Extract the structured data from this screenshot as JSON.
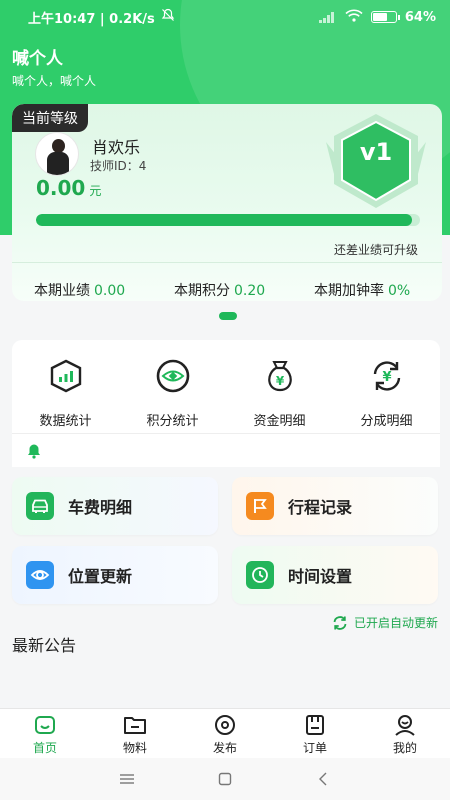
{
  "status_bar": {
    "time": "上午10:47 | 0.2K/s",
    "battery": "64",
    "battery_level": 64
  },
  "header": {
    "title": "喊个人",
    "subtitle": "喊个人，喊个人"
  },
  "level_card": {
    "tag": "当前等级",
    "name": "肖欢乐",
    "tech_id": "技师ID：4",
    "amount": "0.00",
    "currency": "元",
    "level": "v1",
    "progress": 0.98,
    "upgrade_hint": "还差业绩可升级",
    "stats": [
      {
        "label": "本期业绩",
        "value": "0.00"
      },
      {
        "label": "本期积分",
        "value": "0.20"
      },
      {
        "label": "本期加钟率",
        "value": "0%"
      }
    ]
  },
  "quick_actions": [
    {
      "label": "数据统计",
      "icon": "chart-hexagon-icon"
    },
    {
      "label": "积分统计",
      "icon": "eye-points-icon"
    },
    {
      "label": "资金明细",
      "icon": "money-bag-icon"
    },
    {
      "label": "分成明细",
      "icon": "yuan-refresh-icon"
    }
  ],
  "tiles": [
    {
      "label": "车费明细",
      "icon": "car-icon",
      "color": "#22b55a"
    },
    {
      "label": "行程记录",
      "icon": "flag-icon",
      "color": "#f58a1f"
    },
    {
      "label": "位置更新",
      "icon": "location-eye-icon",
      "color": "#2f94f0"
    },
    {
      "label": "时间设置",
      "icon": "clock-icon",
      "color": "#22b55a"
    }
  ],
  "auto_update": "已开启自动更新",
  "announcements_title": "最新公告",
  "tabs": [
    {
      "label": "首页",
      "icon": "home-icon",
      "active": true
    },
    {
      "label": "物料",
      "icon": "folder-icon",
      "active": false
    },
    {
      "label": "发布",
      "icon": "publish-icon",
      "active": false
    },
    {
      "label": "订单",
      "icon": "order-icon",
      "active": false
    },
    {
      "label": "我的",
      "icon": "profile-icon",
      "active": false
    }
  ],
  "colors": {
    "brand": "#2fcd6a",
    "accent": "#1fa84f"
  }
}
